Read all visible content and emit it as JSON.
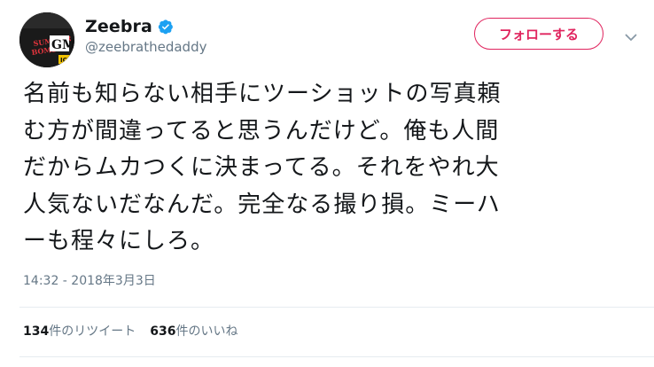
{
  "author": {
    "display_name": "Zeebra",
    "handle": "@zeebrathedaddy",
    "verified_icon": "verified-badge-icon",
    "avatar_lettering": "SUMMER BOMB GM"
  },
  "header": {
    "follow_label": "フォローする",
    "more_icon": "chevron-down-icon"
  },
  "tweet": {
    "lines": [
      "名前も知らない相手にツーショットの写真頼",
      "む方が間違ってると思うんだけど。俺も人間",
      "だからムカつくに決まってる。それをやれ大",
      "人気ないだなんだ。完全なる撮り損。ミーハ",
      "ーも程々にしろ。"
    ],
    "timestamp": "14:32 - 2018年3月3日"
  },
  "stats": {
    "retweets": {
      "count": "134",
      "label": "件のリツイート"
    },
    "likes": {
      "count": "636",
      "label": "件のいいね"
    }
  },
  "colors": {
    "accent": "#e0245e",
    "verified": "#1da1f2",
    "text_primary": "#14171a",
    "text_secondary": "#657786",
    "divider": "#e6ecf0"
  }
}
